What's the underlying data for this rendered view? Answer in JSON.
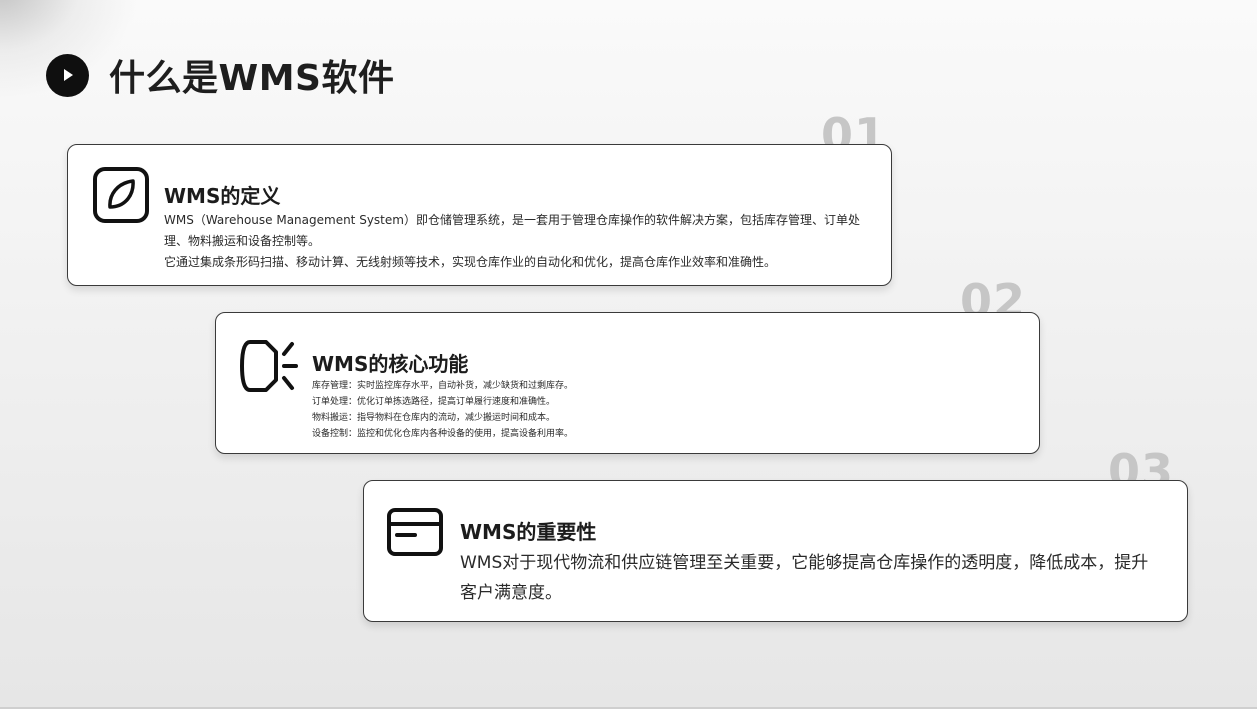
{
  "page": {
    "title": "什么是WMS软件"
  },
  "cards": [
    {
      "number": "01",
      "icon": "leaf-icon",
      "title": "WMS的定义",
      "paragraphs": [
        "WMS（Warehouse Management System）即仓储管理系统，是一套用于管理仓库操作的软件解决方案，包括库存管理、订单处理、物料搬运和设备控制等。",
        "它通过集成条形码扫描、移动计算、无线射频等技术，实现仓库作业的自动化和优化，提高仓库作业效率和准确性。"
      ]
    },
    {
      "number": "02",
      "icon": "speaker-icon",
      "title": "WMS的核心功能",
      "paragraphs": [
        "库存管理：实时监控库存水平，自动补货，减少缺货和过剩库存。",
        "订单处理：优化订单拣选路径，提高订单履行速度和准确性。",
        "物料搬运：指导物料在仓库内的流动，减少搬运时间和成本。",
        "设备控制：监控和优化仓库内各种设备的使用，提高设备利用率。"
      ]
    },
    {
      "number": "03",
      "icon": "credit-card-icon",
      "title": "WMS的重要性",
      "paragraphs": [
        "WMS对于现代物流和供应链管理至关重要，它能够提高仓库操作的透明度，降低成本，提升客户满意度。"
      ]
    }
  ],
  "colors": {
    "accent": "#0f0f0f",
    "number": "#c6c6c6",
    "card_border": "#3a3a3a"
  }
}
